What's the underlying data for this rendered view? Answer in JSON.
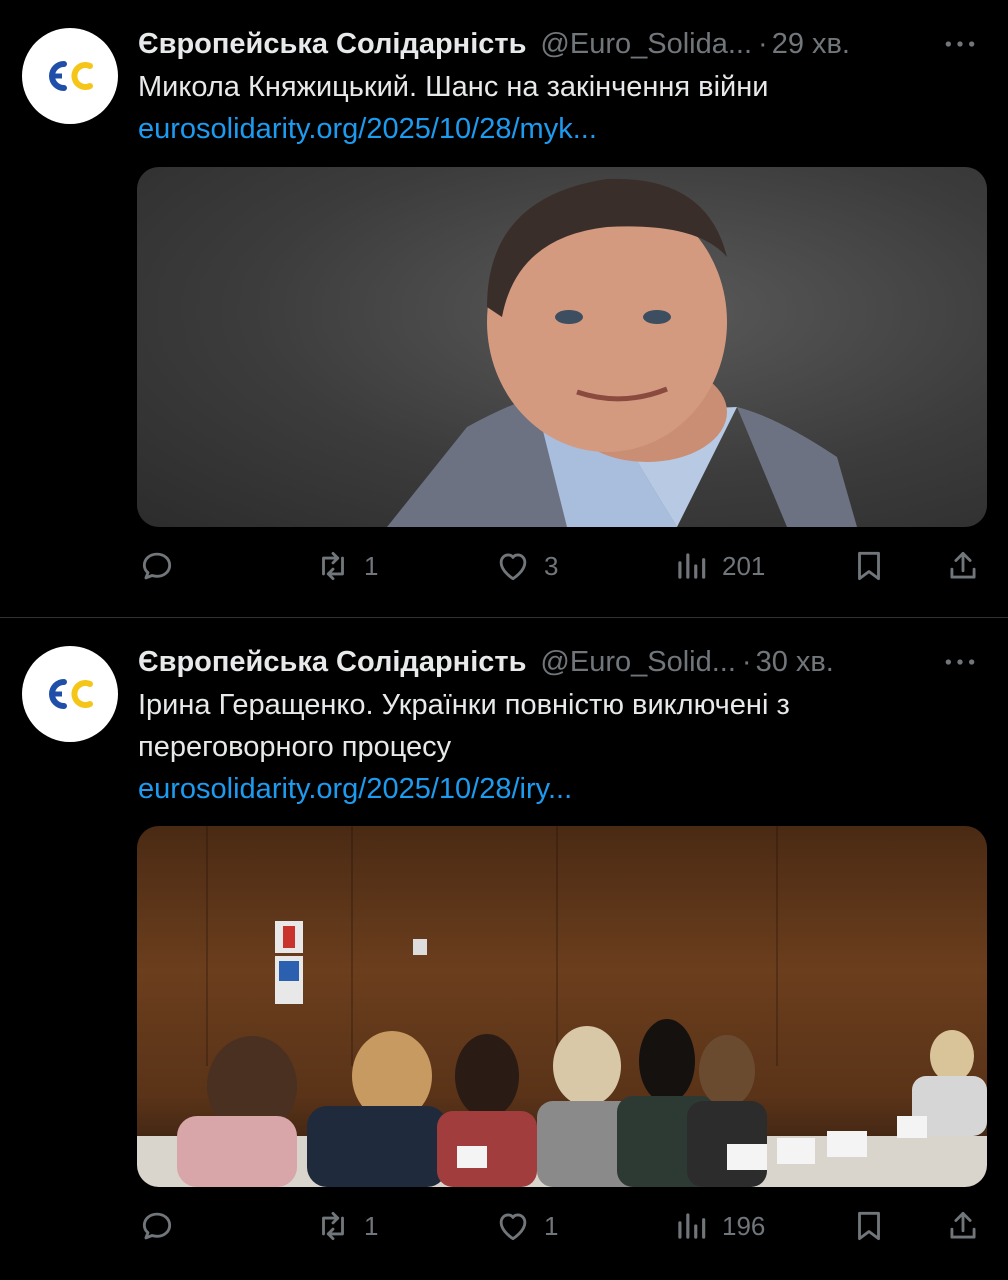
{
  "tweets": [
    {
      "author_name": "Європейська Солідарність",
      "handle": "@Euro_Solida...",
      "time": "29 хв.",
      "text": "Микола Княжицький. Шанс на закінчення війни",
      "link": "eurosolidarity.org/2025/10/28/myk...",
      "avatar_text": "ЄС",
      "replies": "",
      "retweets": "1",
      "likes": "3",
      "views": "201"
    },
    {
      "author_name": "Європейська Солідарність",
      "handle": "@Euro_Solid...",
      "time": "30 хв.",
      "text": "Ірина Геращенко. Українки повністю виключені з переговорного процесу",
      "link": "eurosolidarity.org/2025/10/28/iry...",
      "avatar_text": "ЄС",
      "replies": "",
      "retweets": "1",
      "likes": "1",
      "views": "196"
    }
  ],
  "colors": {
    "background": "#000000",
    "primary_text": "#e7e9ea",
    "secondary_text": "#71767b",
    "link": "#1d9bf0",
    "logo_blue": "#1f4fa8",
    "logo_yellow": "#f5c518"
  },
  "icons": {
    "more": "more-dots-icon",
    "reply": "reply-icon",
    "retweet": "retweet-icon",
    "like": "heart-icon",
    "views": "views-icon",
    "bookmark": "bookmark-icon",
    "share": "share-icon"
  }
}
